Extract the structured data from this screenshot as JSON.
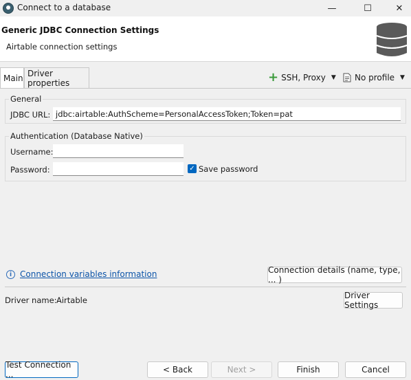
{
  "window": {
    "title": "Connect to a database",
    "minimize": "—",
    "maximize": "☐",
    "close": "✕"
  },
  "header": {
    "title": "Generic JDBC Connection Settings",
    "subtitle": "Airtable connection settings"
  },
  "tabs": [
    {
      "label": "Main",
      "active": true
    },
    {
      "label": "Driver properties",
      "active": false
    }
  ],
  "toolbar": {
    "ssh_proxy": "SSH, Proxy",
    "profile": "No profile"
  },
  "general": {
    "group_label": "General",
    "jdbc_label": "JDBC URL:",
    "jdbc_value": "jdbc:airtable:AuthScheme=PersonalAccessToken;Token=pat"
  },
  "auth": {
    "group_label": "Authentication (Database Native)",
    "username_label": "Username:",
    "username_value": "",
    "password_label": "Password:",
    "password_value": "",
    "save_password_label": "Save password",
    "save_password_checked": true
  },
  "links": {
    "connection_vars": "Connection variables information",
    "connection_details_button": "Connection details (name, type, ... )"
  },
  "driver": {
    "label": "Driver name:",
    "value": "Airtable",
    "settings_button": "Driver Settings"
  },
  "footer": {
    "test_connection": "Test Connection ...",
    "back": "< Back",
    "next": "Next >",
    "finish": "Finish",
    "cancel": "Cancel"
  },
  "colors": {
    "accent": "#0067c0",
    "link": "#0a53a8",
    "plus_green": "#3a9a3a"
  }
}
